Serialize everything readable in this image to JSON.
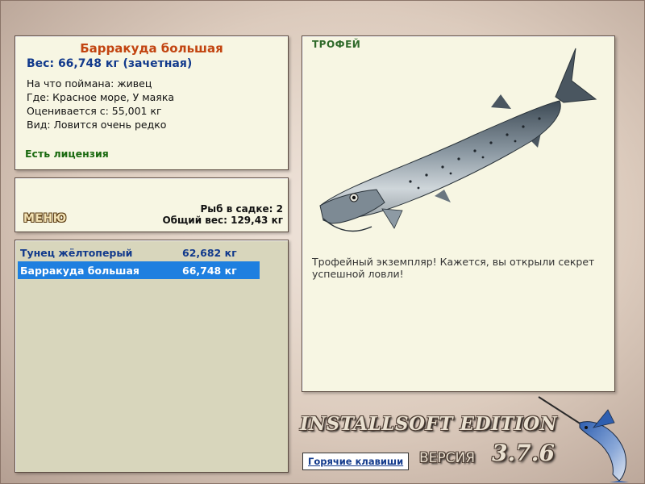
{
  "info": {
    "fish_name": "Барракуда большая",
    "weight": "Вес: 66,748 кг (зачетная)",
    "bait": "На что поймана: живец",
    "place": "Где: Красное море, У маяка",
    "threshold": "Оценивается с: 55,001 кг",
    "rarity": "Вид: Ловится очень редко",
    "license": "Есть лицензия"
  },
  "menu": {
    "label": "МЕНЮ",
    "keep_count": "Рыб в садке: 2",
    "keep_weight": "Общий вес: 129,43 кг"
  },
  "catch_list": [
    {
      "name": "Тунец жёлтоперый",
      "weight": "62,682 кг",
      "selected": false
    },
    {
      "name": "Барракуда большая",
      "weight": "66,748 кг",
      "selected": true
    }
  ],
  "trophy": {
    "label": "ТРОФЕЙ",
    "text": "Трофейный экземпляр! Кажется, вы открыли секрет успешной ловли!",
    "image_icon": "barracuda-image"
  },
  "footer": {
    "edition": "INSTALLSOFT EDITION",
    "version_word": "ВЕРСИЯ",
    "version_number": "3.7.6",
    "hotkeys_label": "Горячие клавиши",
    "logo_icon": "marlin-icon"
  },
  "colors": {
    "fish_name": "#c24410",
    "weight": "#123a8c",
    "license": "#1a6a10",
    "selection": "#1e7fe0",
    "panel_bg": "#f7f6e3"
  }
}
